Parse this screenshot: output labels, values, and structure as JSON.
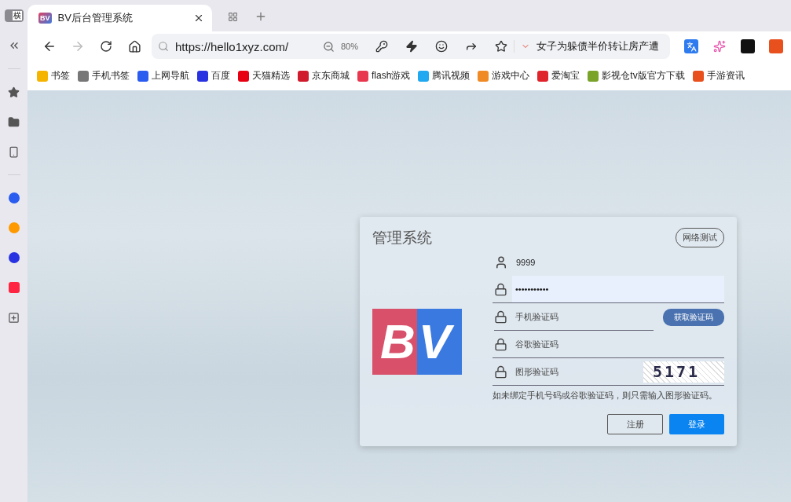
{
  "sidebar": {
    "badge": "横",
    "items": [
      {
        "kind": "star"
      },
      {
        "kind": "folder"
      },
      {
        "kind": "phone"
      },
      {
        "kind": "divider"
      },
      {
        "kind": "q",
        "color": "#2b5cf0"
      },
      {
        "kind": "ring",
        "color": "#ff9900"
      },
      {
        "kind": "paw",
        "color": "#2932e1"
      },
      {
        "kind": "red",
        "color": "#ff2442"
      },
      {
        "kind": "add"
      }
    ]
  },
  "tab": {
    "title": "BV后台管理系统",
    "logo": "BV",
    "selected": true
  },
  "address": {
    "url": "https://hello1xyz.com/",
    "zoom": "80%",
    "search_text": "女子为躲债半价转让房产遭"
  },
  "bookmarks": [
    {
      "label": "书签",
      "color": "#f5b400"
    },
    {
      "label": "手机书签",
      "color": "#777777"
    },
    {
      "label": "上网导航",
      "color": "#2b5cf0"
    },
    {
      "label": "百度",
      "color": "#2932e1"
    },
    {
      "label": "天猫精选",
      "color": "#e60012"
    },
    {
      "label": "京东商城",
      "color": "#d01b2c"
    },
    {
      "label": "flash游戏",
      "color": "#e8384f"
    },
    {
      "label": "腾讯视频",
      "color": "#20a8f0"
    },
    {
      "label": "游戏中心",
      "color": "#f08a24"
    },
    {
      "label": "爱淘宝",
      "color": "#e0242c"
    },
    {
      "label": "影视仓tv版官方下载",
      "color": "#7aa32a"
    },
    {
      "label": "手游资讯",
      "color": "#e8501e"
    }
  ],
  "login": {
    "title": "管理系统",
    "network_test": "网络测试",
    "logo": "BV",
    "fields": [
      {
        "kind": "user",
        "value": "9999",
        "focused": false
      },
      {
        "kind": "lock",
        "value": "•••••••••••",
        "focused": true
      },
      {
        "kind": "sms",
        "placeholder": "手机验证码",
        "button": "获取验证码",
        "focused": false
      },
      {
        "kind": "lock",
        "placeholder": "谷歌验证码",
        "focused": false
      },
      {
        "kind": "captcha",
        "placeholder": "图形验证码",
        "captcha": "5171",
        "focused": false
      }
    ],
    "hint": "如未绑定手机号码或谷歌验证码，则只需输入图形验证码。",
    "register": "注册",
    "submit": "登录"
  }
}
